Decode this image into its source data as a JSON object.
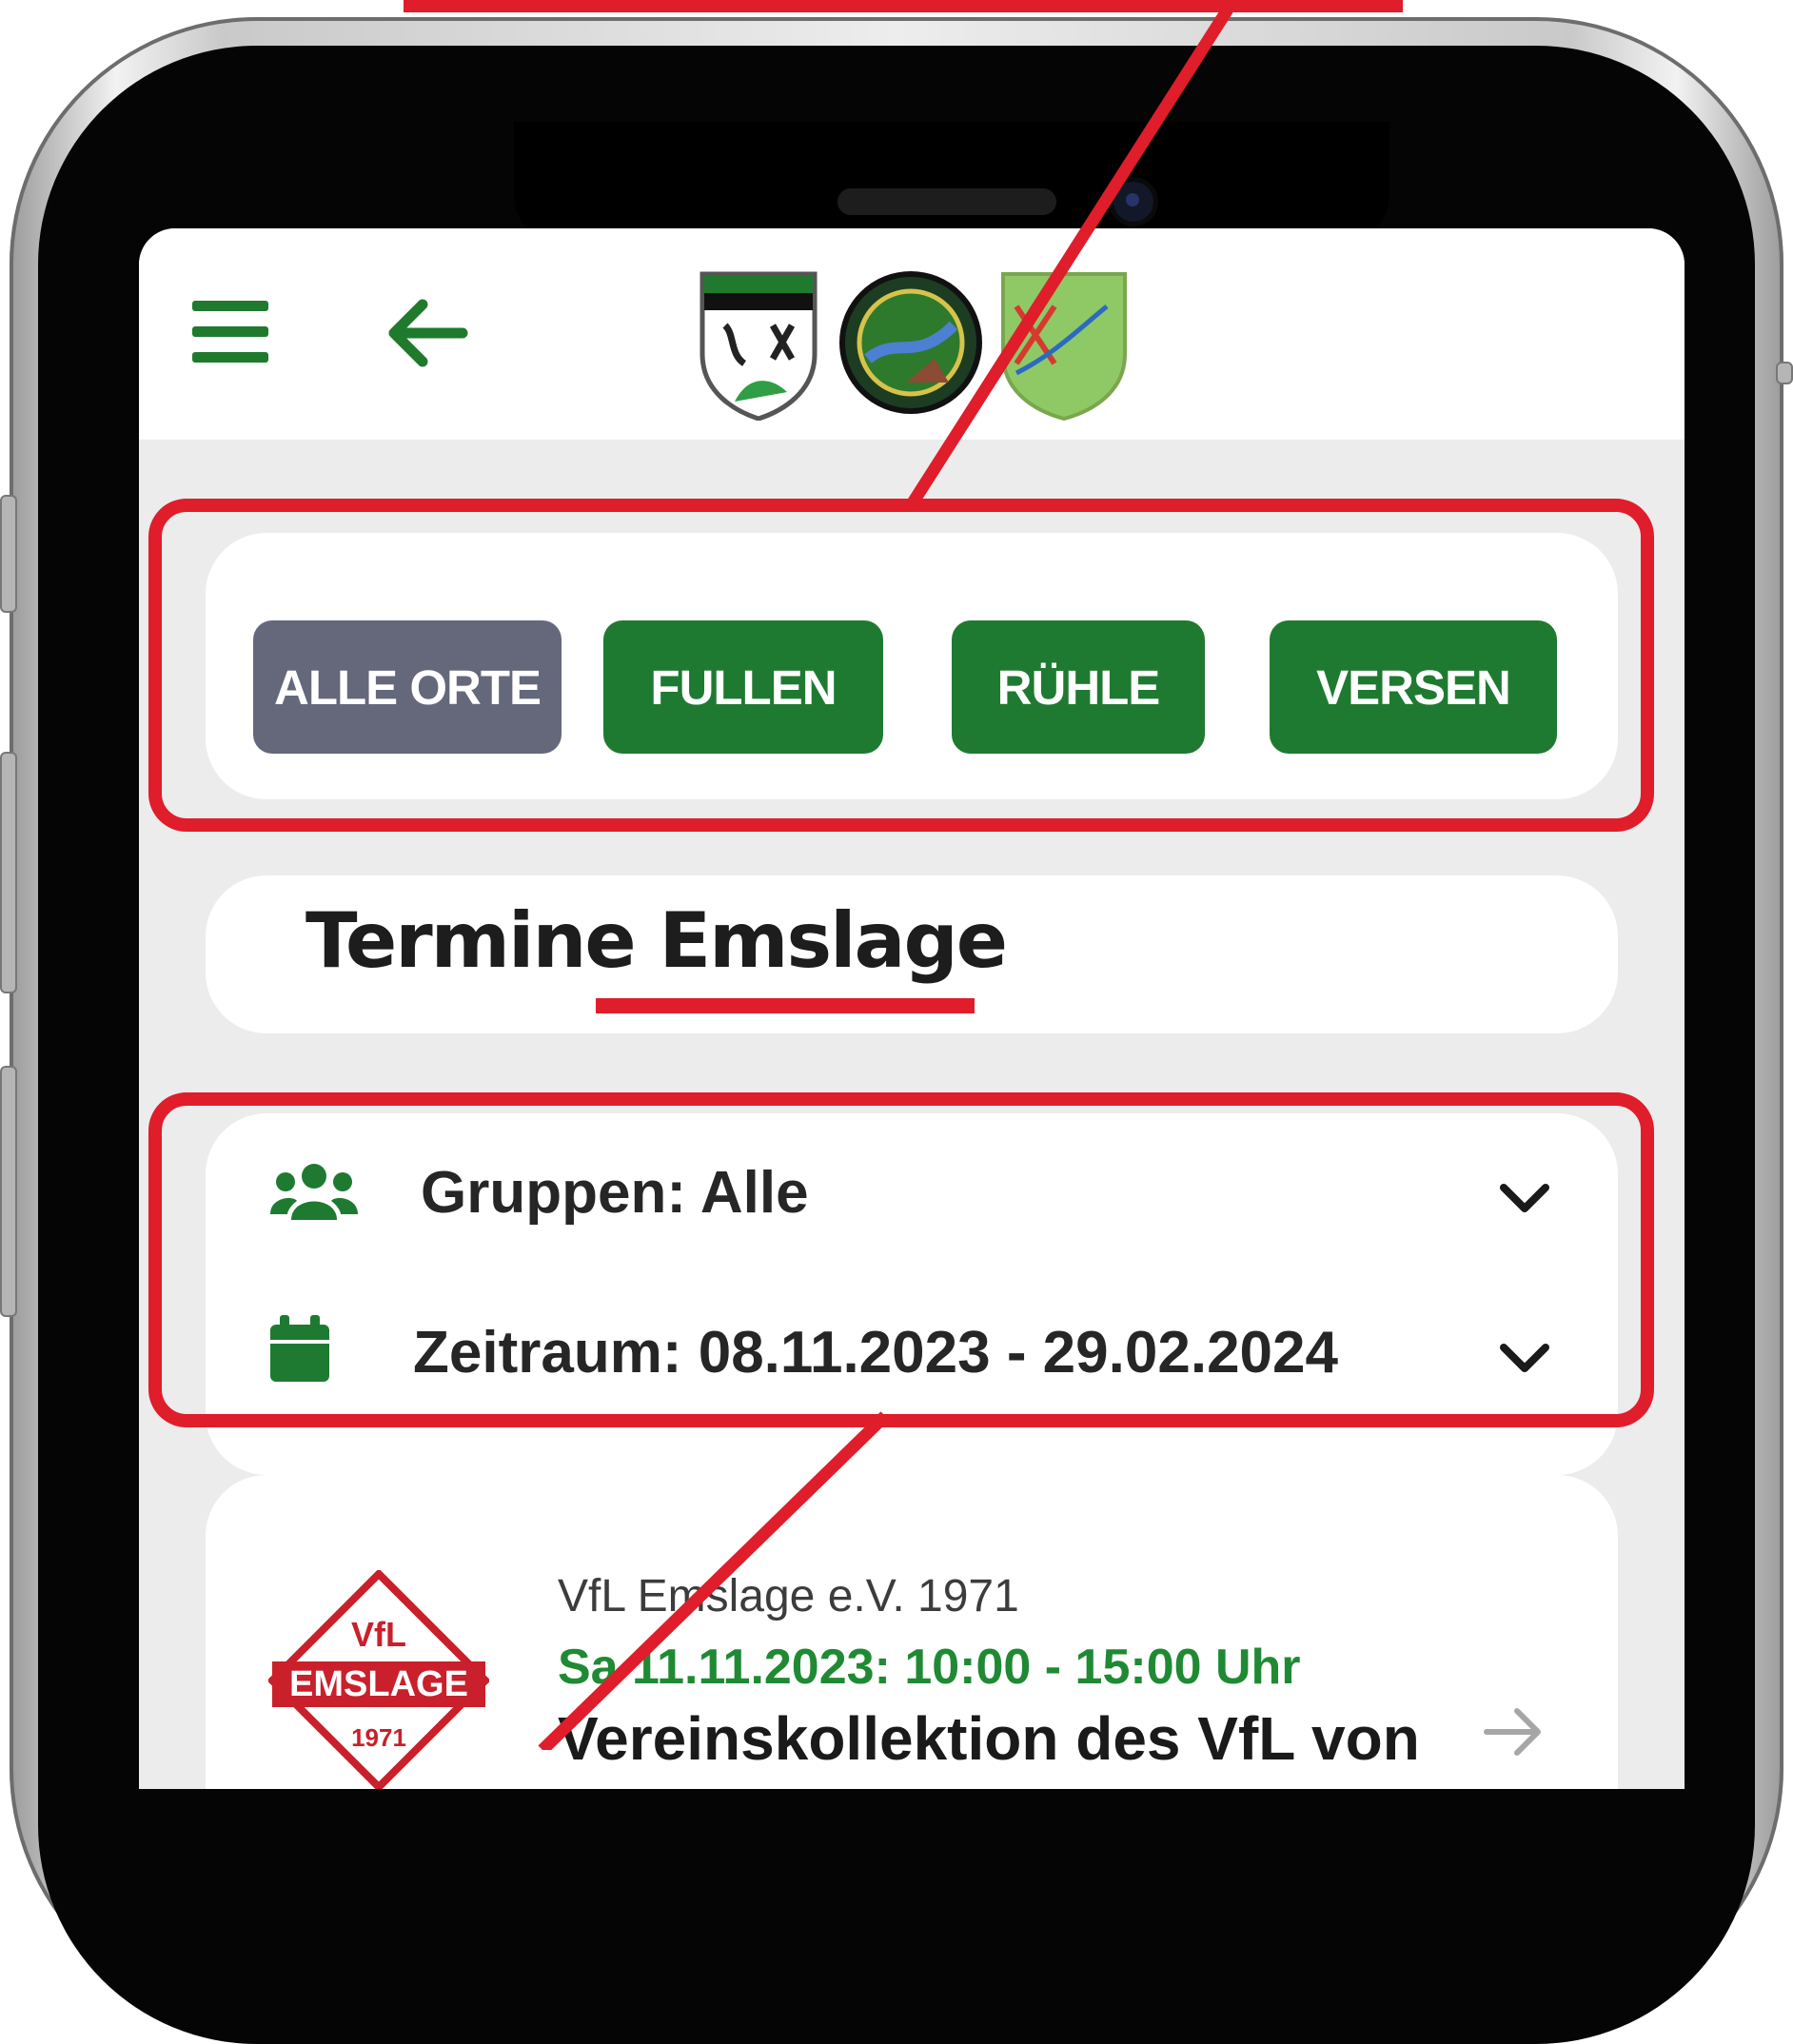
{
  "filter": {
    "buttons": [
      "ALLE ORTE",
      "FULLEN",
      "RÜHLE",
      "VERSEN"
    ],
    "active": "ALLE ORTE"
  },
  "page": {
    "title": "Termine Emslage"
  },
  "filters": {
    "groups_label": "Gruppen: Alle",
    "period_label": "Zeitraum: 08.11.2023 - 29.02.2024"
  },
  "event": {
    "organizer": "VfL Emslage e.V. 1971",
    "datetime": "Sa 11.11.2023: 10:00 - 15:00 Uhr",
    "title": "Vereinskollektion des VfL von",
    "logo_text": "EMSLAGE",
    "logo_top": "VfL",
    "logo_year": "1971"
  },
  "colors": {
    "accent_green": "#1f7a31",
    "inactive_grey": "#64687a",
    "annotation_red": "#e01d2a",
    "event_time_green": "#1f8a33"
  },
  "icons": [
    "menu-icon",
    "arrow-left-icon",
    "users-icon",
    "calendar-icon",
    "chevron-down-icon",
    "arrow-right-icon"
  ]
}
